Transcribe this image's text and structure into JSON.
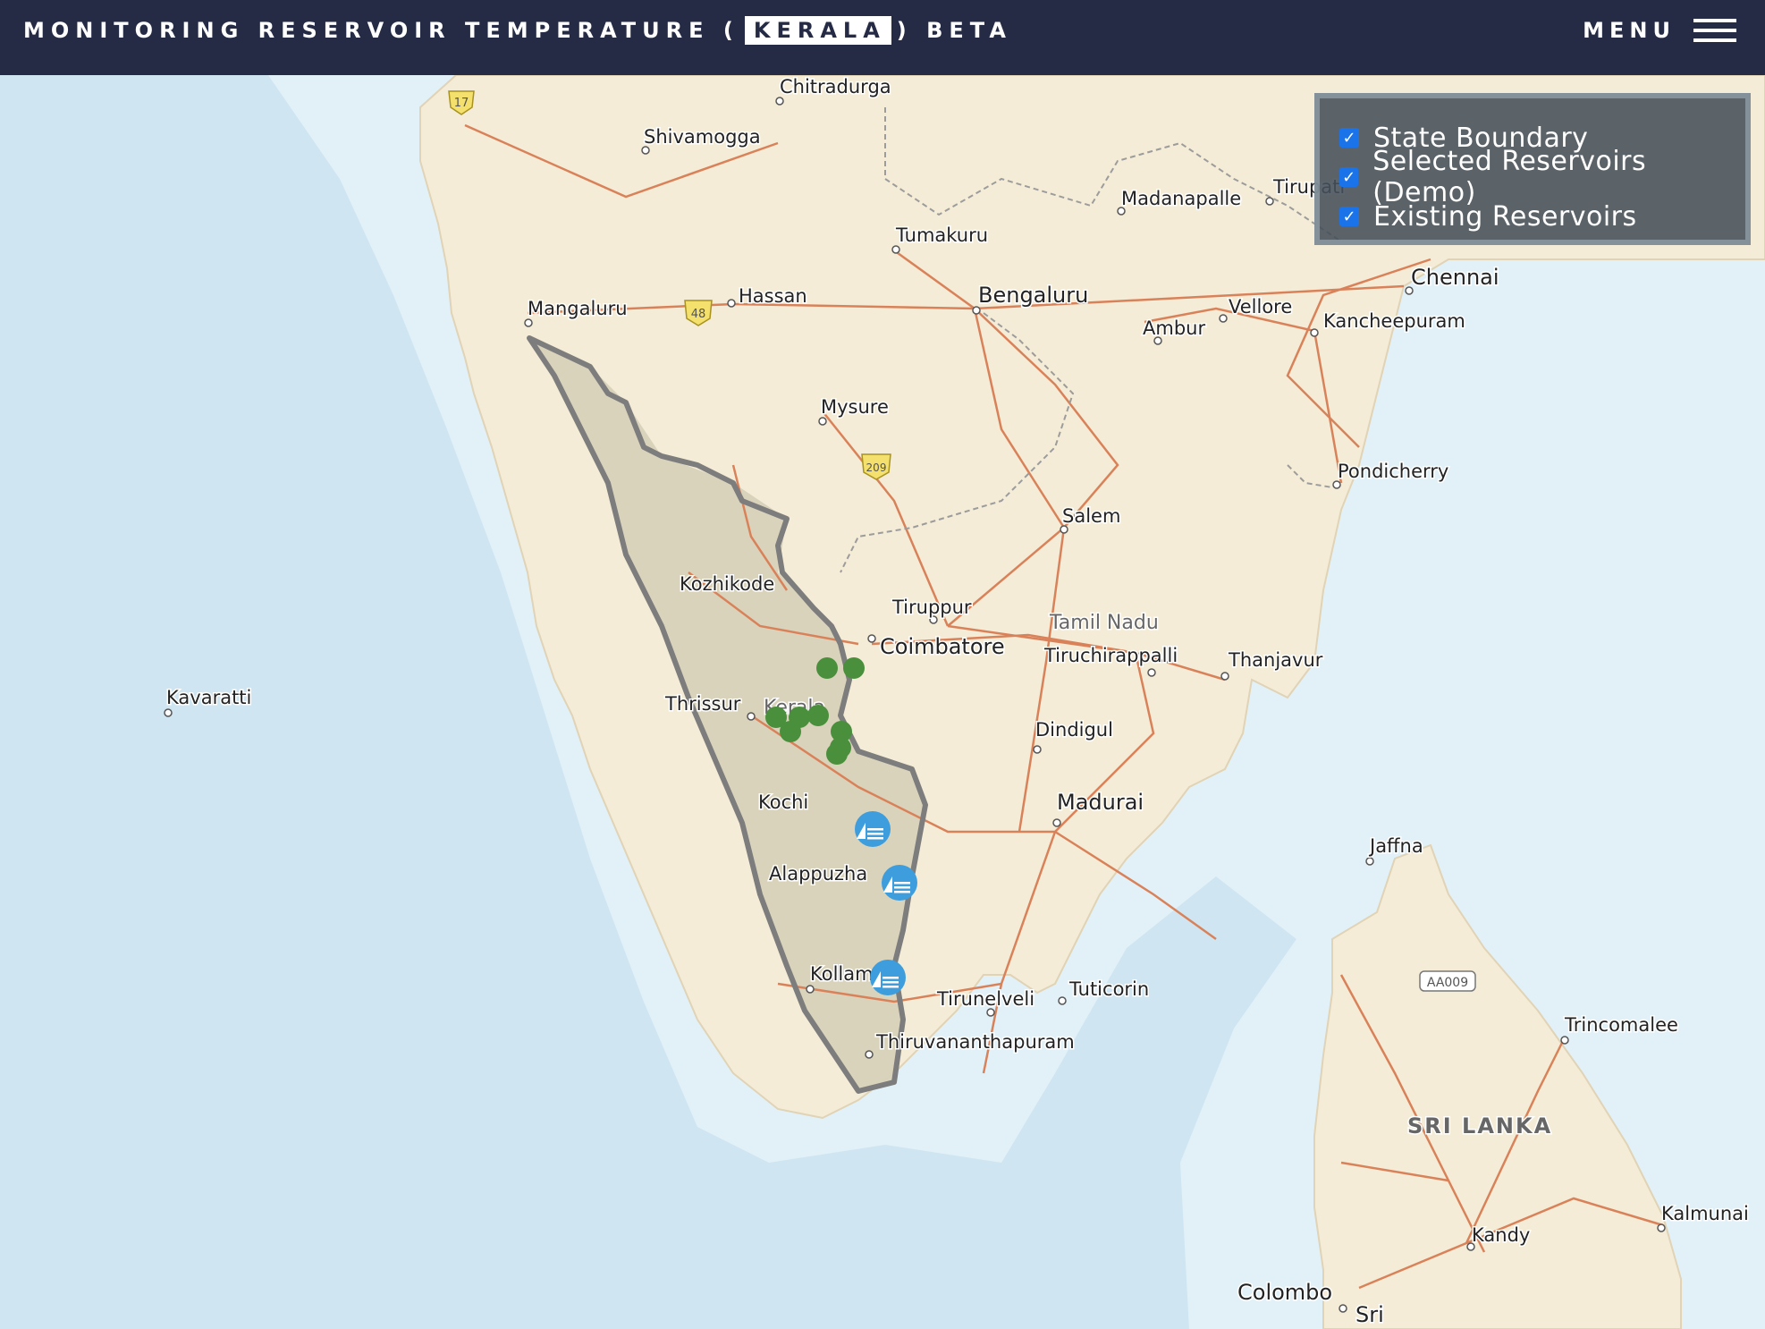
{
  "header": {
    "title_before": "MONITORING RESERVOIR TEMPERATURE (",
    "title_highlight": "KERALA",
    "title_after": ") BETA",
    "menu_label": "MENU"
  },
  "layers": [
    {
      "label": "State Boundary",
      "checked": true
    },
    {
      "label": "Selected Reservoirs (Demo)",
      "checked": true
    },
    {
      "label": "Existing Reservoirs",
      "checked": true
    }
  ],
  "map": {
    "cities": {
      "chitradurga": "Chitradurga",
      "shivamogga": "Shivamogga",
      "madanapalle": "Madanapalle",
      "tirupati": "Tirupati",
      "tumakuru": "Tumakuru",
      "chennai": "Chennai",
      "mangaluru": "Mangaluru",
      "hassan": "Hassan",
      "bengaluru": "Bengaluru",
      "vellore": "Vellore",
      "ambur": "Ambur",
      "kancheepuram": "Kancheepuram",
      "mysure": "Mysure",
      "pondicherry": "Pondicherry",
      "salem": "Salem",
      "kozhikode": "Kozhikode",
      "tiruppur": "Tiruppur",
      "coimbatore": "Coimbatore",
      "tamil_nadu": "Tamil Nadu",
      "tiruchirappalli": "Tiruchirappalli",
      "thanjavur": "Thanjavur",
      "kavaratti": "Kavaratti",
      "thrissur": "Thrissur",
      "kerala": "Kerala",
      "dindigul": "Dindigul",
      "kochi": "Kochi",
      "madurai": "Madurai",
      "jaffna": "Jaffna",
      "alappuzha": "Alappuzha",
      "kollam": "Kollam",
      "tirunelveli": "Tirunelveli",
      "tuticorin": "Tuticorin",
      "thiruvananthapuram": "Thiruvananthapuram",
      "trincomalee": "Trincomalee",
      "sri_lanka": "SRI LANKA",
      "kalmunai": "Kalmunai",
      "kandy": "Kandy",
      "colombo": "Colombo",
      "sri": "Sri"
    },
    "highway_shields": [
      "17",
      "48",
      "209",
      "AA009"
    ],
    "colors": {
      "ocean": "#cfe6f2",
      "shelf": "#e2f1f8",
      "land": "#f4ecd6",
      "kerala_fill": "#d8d2bb",
      "boundary": "#7d7d7d",
      "roads": "#d9825a",
      "selected_reservoir": "#4a8f3c",
      "existing_reservoir": "#3d9ddd"
    },
    "icons": {
      "selected_reservoir": "green-dot",
      "existing_reservoir": "dam-icon"
    }
  }
}
